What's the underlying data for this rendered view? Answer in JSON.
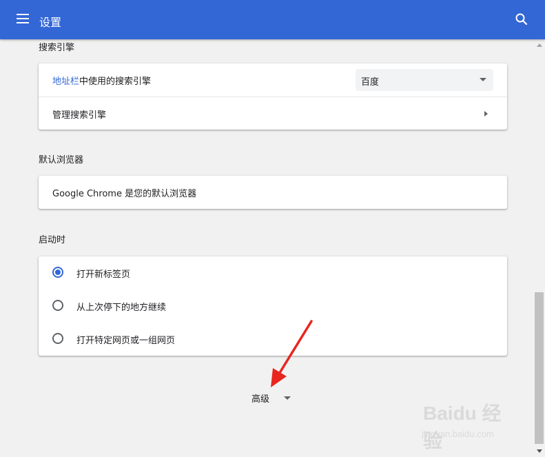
{
  "header": {
    "title": "设置"
  },
  "search_engine": {
    "section_title": "搜索引擎",
    "address_bar_link": "地址栏",
    "address_bar_rest": "中使用的搜索引擎",
    "selected_engine": "百度",
    "manage_label": "管理搜索引擎"
  },
  "default_browser": {
    "section_title": "默认浏览器",
    "status_text": "Google Chrome 是您的默认浏览器"
  },
  "on_startup": {
    "section_title": "启动时",
    "options": [
      {
        "label": "打开新标签页",
        "checked": true
      },
      {
        "label": "从上次停下的地方继续",
        "checked": false
      },
      {
        "label": "打开特定网页或一组网页",
        "checked": false
      }
    ]
  },
  "advanced": {
    "label": "高级"
  },
  "watermark": {
    "logo_text": "Baidu 经验",
    "url": "jingyan.baidu.com"
  },
  "colors": {
    "header_bg": "#3367d6",
    "accent": "#3367d6",
    "annotation_arrow": "#e8251f"
  },
  "icons": {
    "menu": "hamburger-icon",
    "search": "search-icon",
    "dropdown": "dropdown-arrow-icon",
    "chevron": "chevron-right-icon"
  }
}
